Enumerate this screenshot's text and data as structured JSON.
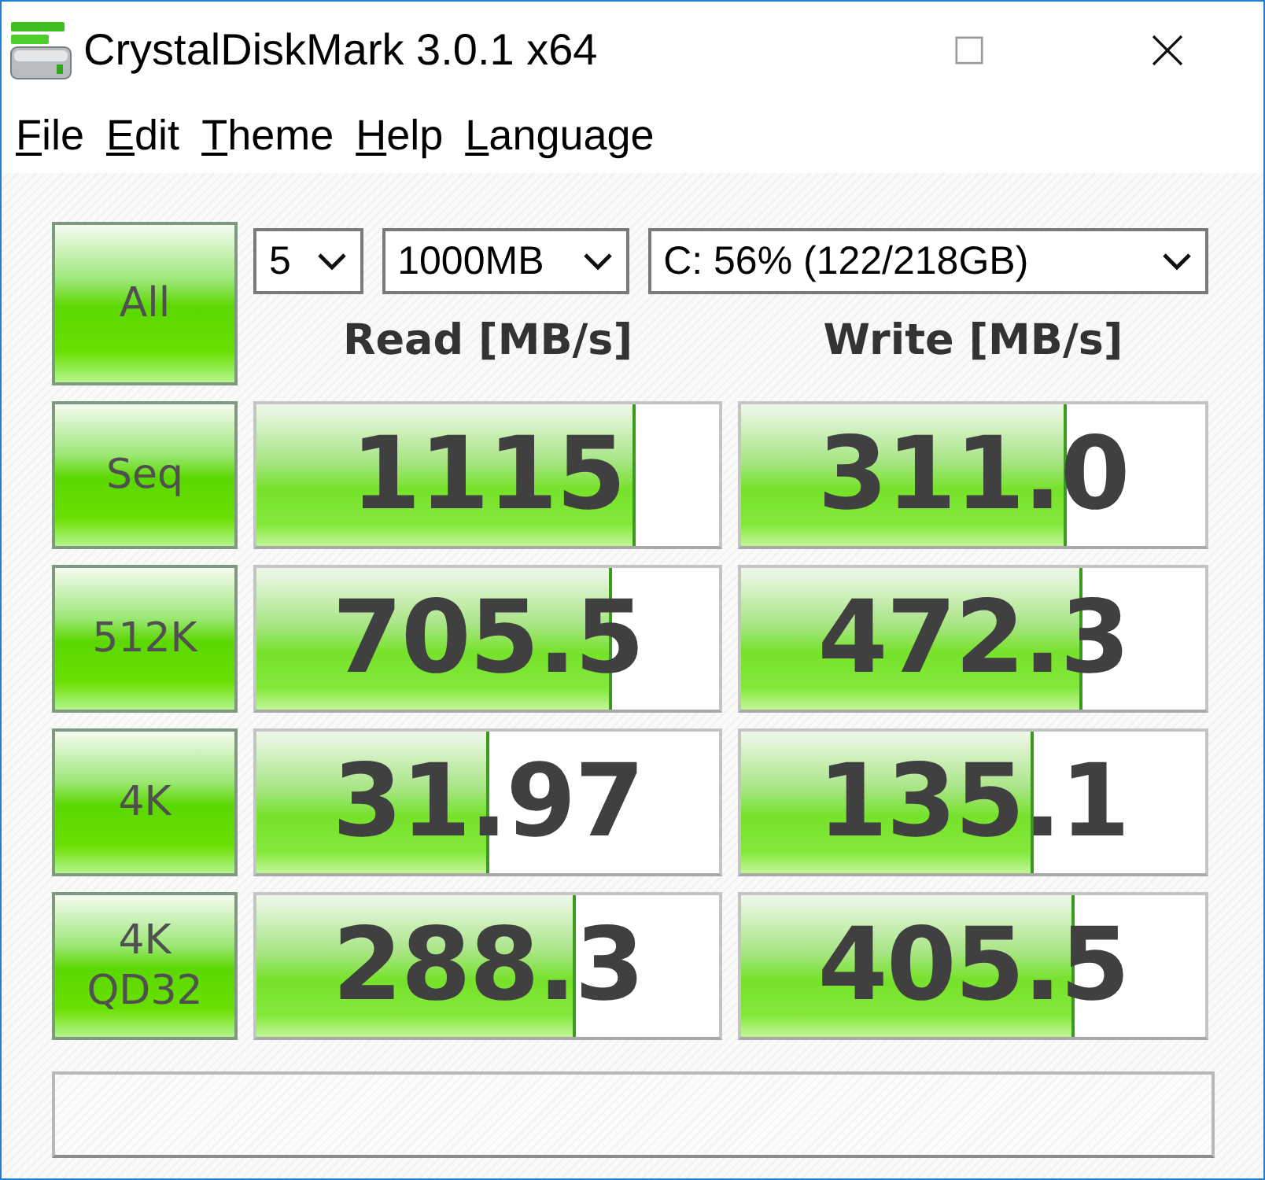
{
  "window": {
    "title": "CrystalDiskMark 3.0.1 x64"
  },
  "menu": [
    {
      "label": "File"
    },
    {
      "label": "Edit"
    },
    {
      "label": "Theme"
    },
    {
      "label": "Help"
    },
    {
      "label": "Language"
    }
  ],
  "all_button": {
    "label": "All"
  },
  "settings": [
    {
      "kind": "count",
      "value": "5"
    },
    {
      "kind": "size",
      "value": "1000MB"
    },
    {
      "kind": "drive",
      "value": "C: 56% (122/218GB)"
    }
  ],
  "columns": [
    "Read [MB/s]",
    "Write [MB/s]"
  ],
  "tests": [
    {
      "label": "Seq",
      "read": {
        "value": "1115",
        "level": 0.82
      },
      "write": {
        "value": "311.0",
        "level": 0.7
      }
    },
    {
      "label": "512K",
      "read": {
        "value": "705.5",
        "level": 0.77
      },
      "write": {
        "value": "472.3",
        "level": 0.735
      }
    },
    {
      "label": "4K",
      "read": {
        "value": "31.97",
        "level": 0.505
      },
      "write": {
        "value": "135.1",
        "level": 0.63
      }
    },
    {
      "label": "4K\nQD32",
      "read": {
        "value": "288.3",
        "level": 0.69
      },
      "write": {
        "value": "405.5",
        "level": 0.72
      }
    }
  ]
}
